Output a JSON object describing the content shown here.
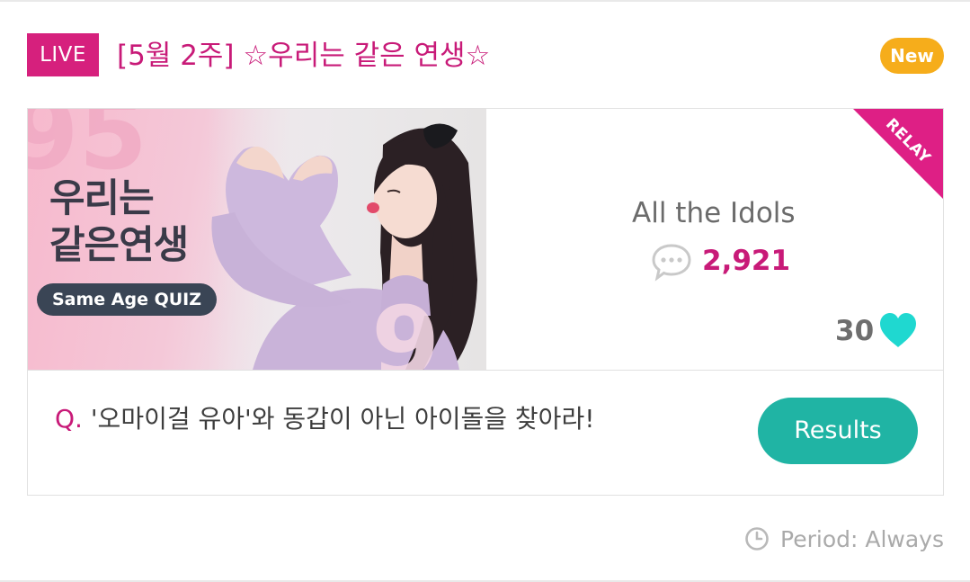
{
  "header": {
    "live_label": "LIVE",
    "title": "[5월 2주] ☆우리는 같은 연생☆",
    "new_label": "New"
  },
  "card": {
    "thumbnail": {
      "title_line1": "우리는",
      "title_line2": "같은연생",
      "pill": "Same Age QUIZ",
      "bg_number_top": "95",
      "bg_number_bottom": "9"
    },
    "relay_label": "RELAY",
    "source_name": "All the Idols",
    "comment_count": "2,921",
    "likes_count": "30",
    "question_prefix": "Q.",
    "question_text": "'오마이걸 유아'와 동갑이 아닌 아이돌을 찾아라!",
    "results_label": "Results"
  },
  "footer": {
    "period": "Period: Always"
  },
  "colors": {
    "brand_pink": "#d6207d",
    "title_pink": "#c81a78",
    "new_orange": "#f6ad1b",
    "results_teal": "#20b4a4",
    "heart_cyan": "#1fd8d0"
  },
  "icons": {
    "comment": "speech-bubble-icon",
    "likes": "heart-icon",
    "period": "clock-icon"
  }
}
